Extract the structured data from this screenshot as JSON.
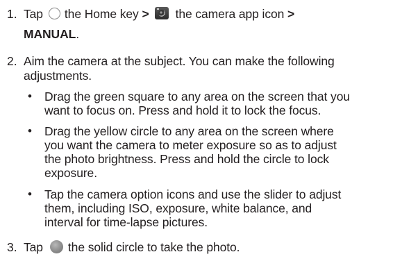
{
  "steps": {
    "s1": {
      "num": "1.",
      "part1": "Tap",
      "part2": "the Home key",
      "part3": ">",
      "part4": "the camera app icon",
      "part5": ">",
      "line2": "MANUAL",
      "line2_end": "."
    },
    "s2": {
      "num": "2.",
      "line1": "Aim the camera at the subject. You can make the following",
      "line2": "adjustments."
    },
    "bullets": [
      {
        "lines": [
          "Drag the green square to any area on the screen that you",
          "want to focus on. Press and hold it to lock the focus."
        ]
      },
      {
        "lines": [
          "Drag the yellow circle to any area on the screen where",
          "you want the camera to meter exposure so as to adjust",
          "the photo brightness. Press and hold the circle to lock",
          "exposure."
        ]
      },
      {
        "lines": [
          "Tap the camera option icons and use the slider to adjust",
          "them, including ISO, exposure, white balance, and",
          "interval for time-lapse pictures."
        ]
      }
    ],
    "s3": {
      "num": "3.",
      "part1": "Tap",
      "part2": "the solid circle to take the photo."
    },
    "bullet_symbol": "•"
  },
  "icons": {
    "home": "home-key-icon",
    "camera": "camera-app-icon",
    "shutter": "shutter-button-icon"
  }
}
